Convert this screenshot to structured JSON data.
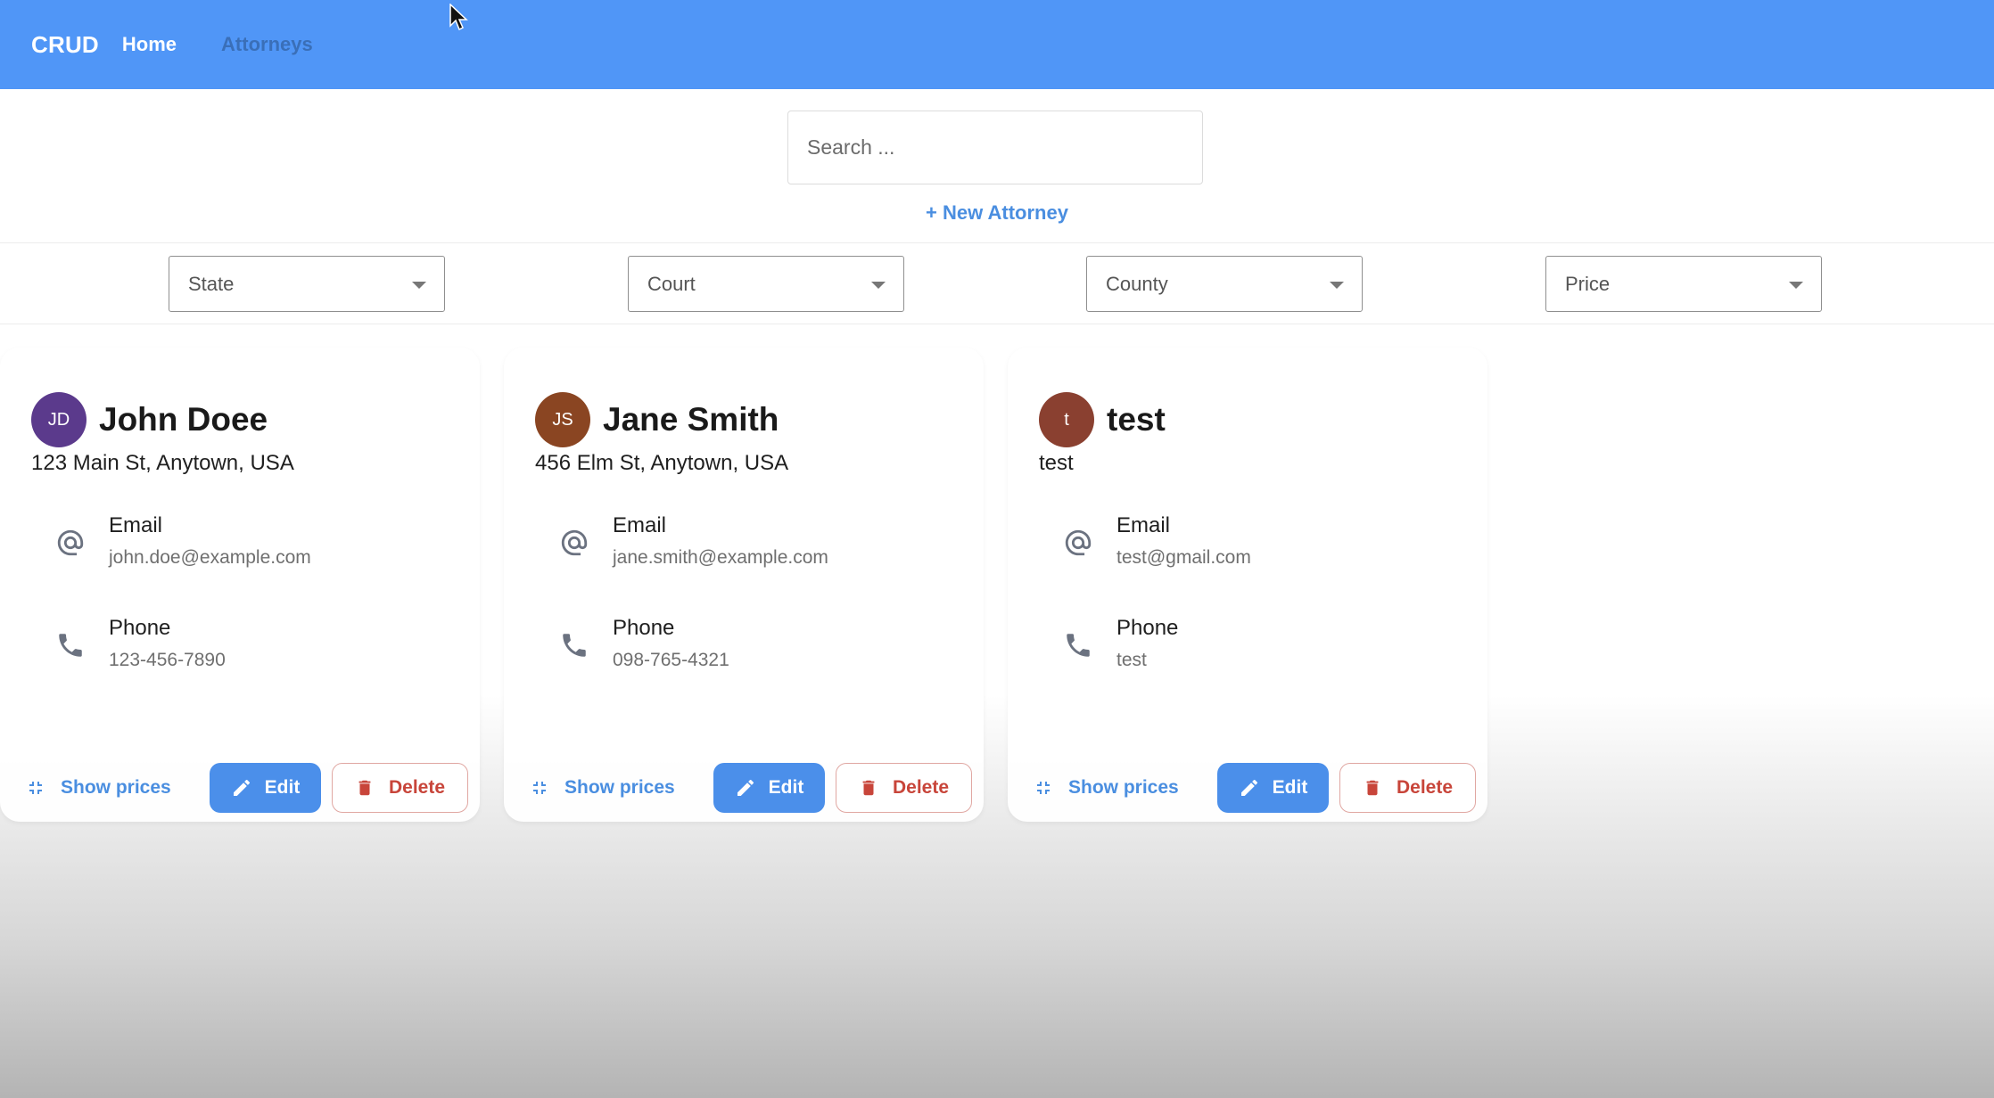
{
  "navbar": {
    "brand": "CRUD",
    "links": [
      {
        "label": "Home",
        "active": true
      },
      {
        "label": "Attorneys",
        "active": false
      }
    ],
    "bg_color": "#5096f7"
  },
  "search": {
    "placeholder": "Search ...",
    "value": ""
  },
  "new_attorney_label": "+ New Attorney",
  "filters": [
    {
      "label": "State"
    },
    {
      "label": "Court"
    },
    {
      "label": "County"
    },
    {
      "label": "Price"
    }
  ],
  "attorneys": [
    {
      "initials": "JD",
      "avatar_color": "#5b3a8c",
      "name": "John Doee",
      "address": "123 Main St, Anytown, USA",
      "email_label": "Email",
      "email": "john.doe@example.com",
      "phone_label": "Phone",
      "phone": "123-456-7890"
    },
    {
      "initials": "JS",
      "avatar_color": "#8a4522",
      "name": "Jane Smith",
      "address": "456 Elm St, Anytown, USA",
      "email_label": "Email",
      "email": "jane.smith@example.com",
      "phone_label": "Phone",
      "phone": "098-765-4321"
    },
    {
      "initials": "t",
      "avatar_color": "#8a4030",
      "name": "test",
      "address": "test",
      "email_label": "Email",
      "email": "test@gmail.com",
      "phone_label": "Phone",
      "phone": "test"
    }
  ],
  "card_actions": {
    "show_prices_label": "Show prices",
    "edit_label": "Edit",
    "delete_label": "Delete"
  },
  "colors": {
    "accent": "#4b8fea",
    "danger": "#c8453a"
  }
}
